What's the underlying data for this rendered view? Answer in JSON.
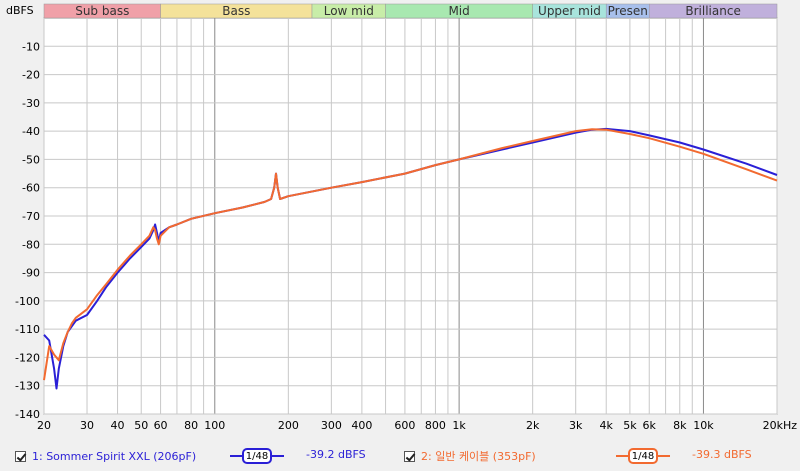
{
  "chart_data": {
    "type": "line",
    "x_scale": "log",
    "xlim": [
      20,
      20000
    ],
    "ylim": [
      -140,
      0
    ],
    "ylabel": "dBFS",
    "grid": true,
    "x_ticks": [
      {
        "value": 20,
        "label": "20"
      },
      {
        "value": 30,
        "label": "30"
      },
      {
        "value": 40,
        "label": "40"
      },
      {
        "value": 50,
        "label": "50"
      },
      {
        "value": 60,
        "label": "60"
      },
      {
        "value": 80,
        "label": "80"
      },
      {
        "value": 100,
        "label": "100"
      },
      {
        "value": 200,
        "label": "200"
      },
      {
        "value": 300,
        "label": "300"
      },
      {
        "value": 400,
        "label": "400"
      },
      {
        "value": 600,
        "label": "600"
      },
      {
        "value": 800,
        "label": "800"
      },
      {
        "value": 1000,
        "label": "1k"
      },
      {
        "value": 2000,
        "label": "2k"
      },
      {
        "value": 3000,
        "label": "3k"
      },
      {
        "value": 4000,
        "label": "4k"
      },
      {
        "value": 5000,
        "label": "5k"
      },
      {
        "value": 6000,
        "label": "6k"
      },
      {
        "value": 8000,
        "label": "8k"
      },
      {
        "value": 10000,
        "label": "10k"
      },
      {
        "value": 20000,
        "label": "20kHz"
      }
    ],
    "y_ticks": [
      -10,
      -20,
      -30,
      -40,
      -50,
      -60,
      -70,
      -80,
      -90,
      -100,
      -110,
      -120,
      -130,
      -140
    ],
    "bands": [
      {
        "label": "Sub bass",
        "from": 20,
        "to": 60,
        "color": "#f0a0a8"
      },
      {
        "label": "Bass",
        "from": 60,
        "to": 250,
        "color": "#f4e29a"
      },
      {
        "label": "Low mid",
        "from": 250,
        "to": 500,
        "color": "#c8eda8"
      },
      {
        "label": "Mid",
        "from": 500,
        "to": 2000,
        "color": "#a8e8b0"
      },
      {
        "label": "Upper mid",
        "from": 2000,
        "to": 4000,
        "color": "#a8e4dc"
      },
      {
        "label": "Presen",
        "from": 4000,
        "to": 6000,
        "color": "#a8c0ec"
      },
      {
        "label": "Brilliance",
        "from": 6000,
        "to": 20000,
        "color": "#c0b0dc"
      }
    ],
    "series": [
      {
        "name": "1: Sommer Spirit XXL (206pF)",
        "color": "#2a1fd6",
        "points": [
          [
            20,
            -112
          ],
          [
            21,
            -114
          ],
          [
            22,
            -124
          ],
          [
            22.5,
            -131
          ],
          [
            23,
            -124
          ],
          [
            24,
            -116
          ],
          [
            25,
            -111
          ],
          [
            27,
            -107
          ],
          [
            30,
            -105
          ],
          [
            33,
            -100
          ],
          [
            36,
            -95
          ],
          [
            40,
            -90
          ],
          [
            45,
            -85
          ],
          [
            50,
            -81
          ],
          [
            54,
            -78
          ],
          [
            56,
            -75
          ],
          [
            57,
            -73
          ],
          [
            58,
            -76
          ],
          [
            59,
            -79
          ],
          [
            60,
            -76
          ],
          [
            65,
            -74
          ],
          [
            70,
            -73
          ],
          [
            80,
            -71
          ],
          [
            100,
            -69
          ],
          [
            130,
            -67
          ],
          [
            160,
            -65
          ],
          [
            170,
            -64
          ],
          [
            175,
            -60
          ],
          [
            178,
            -55
          ],
          [
            181,
            -60
          ],
          [
            185,
            -64
          ],
          [
            200,
            -63
          ],
          [
            300,
            -60
          ],
          [
            400,
            -58
          ],
          [
            600,
            -55
          ],
          [
            800,
            -52
          ],
          [
            1000,
            -50
          ],
          [
            1500,
            -46.5
          ],
          [
            2000,
            -44
          ],
          [
            3000,
            -40.5
          ],
          [
            3500,
            -39.5
          ],
          [
            4000,
            -39.2
          ],
          [
            5000,
            -40
          ],
          [
            6000,
            -41.5
          ],
          [
            8000,
            -44
          ],
          [
            10000,
            -46.5
          ],
          [
            15000,
            -51.5
          ],
          [
            20000,
            -55.5
          ]
        ]
      },
      {
        "name": "2: 일반 케이블 (353pF)",
        "color": "#f26a30",
        "points": [
          [
            20,
            -128
          ],
          [
            20.5,
            -122
          ],
          [
            21,
            -116
          ],
          [
            22,
            -119
          ],
          [
            23,
            -121
          ],
          [
            24,
            -115
          ],
          [
            25,
            -111
          ],
          [
            26,
            -108
          ],
          [
            27,
            -106
          ],
          [
            30,
            -103
          ],
          [
            33,
            -98
          ],
          [
            36,
            -94
          ],
          [
            40,
            -89
          ],
          [
            45,
            -84
          ],
          [
            50,
            -80
          ],
          [
            54,
            -77
          ],
          [
            56,
            -74
          ],
          [
            57,
            -75
          ],
          [
            58,
            -78
          ],
          [
            59,
            -80
          ],
          [
            60,
            -77
          ],
          [
            65,
            -74
          ],
          [
            70,
            -73
          ],
          [
            80,
            -71
          ],
          [
            100,
            -69
          ],
          [
            130,
            -67
          ],
          [
            160,
            -65
          ],
          [
            170,
            -64
          ],
          [
            175,
            -60
          ],
          [
            178,
            -55
          ],
          [
            181,
            -60
          ],
          [
            185,
            -64
          ],
          [
            200,
            -63
          ],
          [
            300,
            -60
          ],
          [
            400,
            -58
          ],
          [
            600,
            -55
          ],
          [
            800,
            -52
          ],
          [
            1000,
            -50
          ],
          [
            1500,
            -46
          ],
          [
            2000,
            -43.5
          ],
          [
            3000,
            -40
          ],
          [
            3500,
            -39.3
          ],
          [
            4000,
            -39.5
          ],
          [
            5000,
            -41
          ],
          [
            6000,
            -42.5
          ],
          [
            8000,
            -45.5
          ],
          [
            10000,
            -48
          ],
          [
            15000,
            -53.5
          ],
          [
            20000,
            -57.5
          ]
        ]
      }
    ]
  },
  "legend": {
    "item1_label": "1: Sommer Spirit XXL (206pF)",
    "item1_value": "-39.2 dBFS",
    "item1_smoothing": "1/48",
    "item2_label": "2: 일반 케이블 (353pF)",
    "item2_value": "-39.3 dBFS",
    "item2_smoothing": "1/48",
    "colors": {
      "item1": "#2a1fd6",
      "item2": "#f26a30"
    }
  }
}
